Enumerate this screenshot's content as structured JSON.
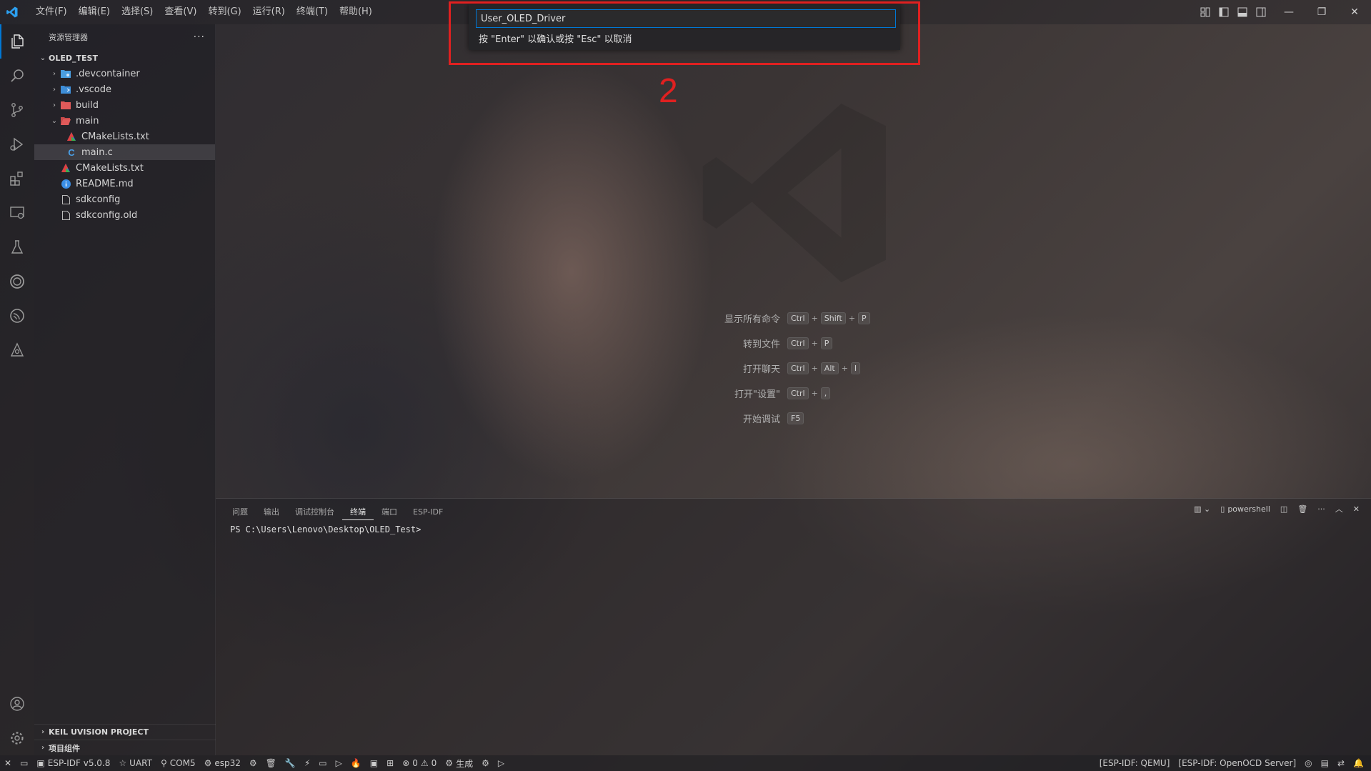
{
  "menu": [
    "文件(F)",
    "编辑(E)",
    "选择(S)",
    "查看(V)",
    "转到(G)",
    "运行(R)",
    "终端(T)",
    "帮助(H)"
  ],
  "sidebar": {
    "title": "资源管理器",
    "more": "···",
    "root": "OLED_TEST",
    "tree": [
      {
        "name": ".devcontainer"
      },
      {
        "name": ".vscode"
      },
      {
        "name": "build"
      },
      {
        "name": "main"
      },
      {
        "name": "CMakeLists.txt"
      },
      {
        "name": "main.c"
      },
      {
        "name": "CMakeLists.txt"
      },
      {
        "name": "README.md"
      },
      {
        "name": "sdkconfig"
      },
      {
        "name": "sdkconfig.old"
      }
    ],
    "bottom_sections": [
      "KEIL UVISION PROJECT",
      "项目组件"
    ]
  },
  "quick_input": {
    "value": "User_OLED_Driver",
    "message": "按 \"Enter\" 以确认或按 \"Esc\" 以取消"
  },
  "annotation_number": "2",
  "shortcuts": [
    {
      "label": "显示所有命令",
      "keys": [
        "Ctrl",
        "Shift",
        "P"
      ]
    },
    {
      "label": "转到文件",
      "keys": [
        "Ctrl",
        "P"
      ]
    },
    {
      "label": "打开聊天",
      "keys": [
        "Ctrl",
        "Alt",
        "I"
      ]
    },
    {
      "label": "打开\"设置\"",
      "keys": [
        "Ctrl",
        ","
      ]
    },
    {
      "label": "开始调试",
      "keys": [
        "F5"
      ]
    }
  ],
  "panel": {
    "tabs": [
      "问题",
      "输出",
      "调试控制台",
      "终端",
      "端口",
      "ESP-IDF"
    ],
    "active_tab": "终端",
    "terminal_name": "powershell",
    "prompt": "PS C:\\Users\\Lenovo\\Desktop\\OLED_Test>"
  },
  "statusbar": {
    "idf_version": "ESP-IDF v5.0.8",
    "uart": "UART",
    "port": "COM5",
    "target": "esp32",
    "problems_errors": "0",
    "problems_warnings": "0",
    "build": "生成",
    "qemu": "[ESP-IDF: QEMU]",
    "openocd": "[ESP-IDF: OpenOCD Server]"
  },
  "colors": {
    "accent": "#0078d4",
    "annotation": "#e02020"
  }
}
